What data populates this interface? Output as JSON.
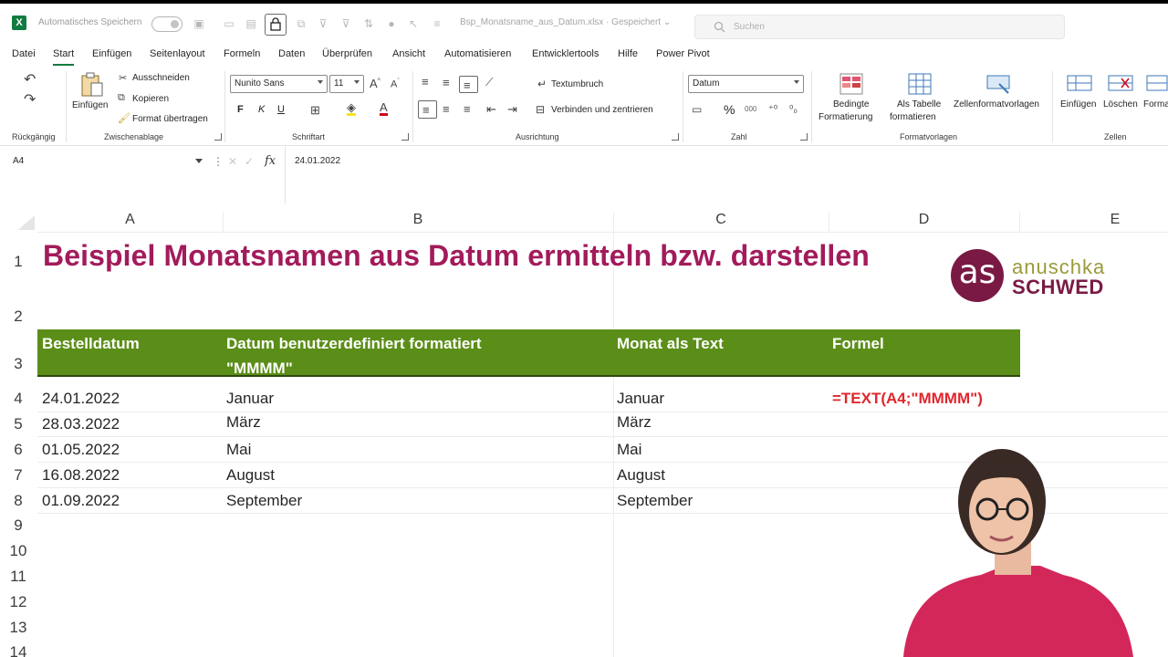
{
  "titlebar": {
    "autosave_label": "Automatisches Speichern",
    "filename": "Bsp_Monatsname_aus_Datum.xlsx  ·  Gespeichert  ⌄",
    "search_placeholder": "Suchen"
  },
  "menu": {
    "tabs": [
      "Datei",
      "Start",
      "Einfügen",
      "Seitenlayout",
      "Formeln",
      "Daten",
      "Überprüfen",
      "Ansicht",
      "Automatisieren",
      "Entwicklertools",
      "Hilfe",
      "Power Pivot"
    ],
    "active": "Start"
  },
  "ribbon": {
    "undo_group": "Rückgängig",
    "clipboard": {
      "group": "Zwischenablage",
      "paste": "Einfügen",
      "cut": "Ausschneiden",
      "copy": "Kopieren",
      "format_painter": "Format übertragen"
    },
    "font": {
      "group": "Schriftart",
      "name": "Nunito Sans",
      "size": "11",
      "bold": "F",
      "italic": "K",
      "underline": "U"
    },
    "alignment": {
      "group": "Ausrichtung",
      "wrap": "Textumbruch",
      "merge": "Verbinden und zentrieren"
    },
    "number": {
      "group": "Zahl",
      "format": "Datum",
      "percent": "%",
      "thousands": "000"
    },
    "styles": {
      "group": "Formatvorlagen",
      "conditional_line1": "Bedingte",
      "conditional_line2": "Formatierung",
      "table_line1": "Als Tabelle",
      "table_line2": "formatieren",
      "cell_styles": "Zellenformatvorlagen"
    },
    "cells": {
      "group": "Zellen",
      "insert": "Einfügen",
      "delete": "Löschen",
      "format": "Forma"
    }
  },
  "formula_bar": {
    "name_box": "A4",
    "fx": "fx",
    "content": "24.01.2022"
  },
  "columns": [
    "A",
    "B",
    "C",
    "D",
    "E"
  ],
  "rows": [
    "1",
    "2",
    "3",
    "4",
    "5",
    "6",
    "7",
    "8",
    "9",
    "10",
    "11",
    "12",
    "13",
    "14"
  ],
  "sheet": {
    "title": "Beispiel Monatsnamen aus Datum ermitteln bzw. darstellen",
    "headers": {
      "a": "Bestelldatum",
      "b_line1": "Datum benutzerdefiniert formatiert",
      "b_line2": "\"MMMM\"",
      "c": "Monat als Text",
      "d": "Formel"
    },
    "data": [
      {
        "a": "24.01.2022",
        "b": "Januar",
        "c": "Januar",
        "d": "=TEXT(A4;\"MMMM\")"
      },
      {
        "a": "28.03.2022",
        "b": "März",
        "c": "März",
        "d": ""
      },
      {
        "a": "01.05.2022",
        "b": "Mai",
        "c": "Mai",
        "d": ""
      },
      {
        "a": "16.08.2022",
        "b": "August",
        "c": "August",
        "d": ""
      },
      {
        "a": "01.09.2022",
        "b": "September",
        "c": "September",
        "d": ""
      }
    ]
  },
  "logo": {
    "mark": "as",
    "line1": "anuschka",
    "line2": "SCHWED"
  },
  "colors": {
    "title": "#a21b5b",
    "header_band": "#5b8e18",
    "formula_text": "#e0262d",
    "excel_green": "#107c41"
  }
}
